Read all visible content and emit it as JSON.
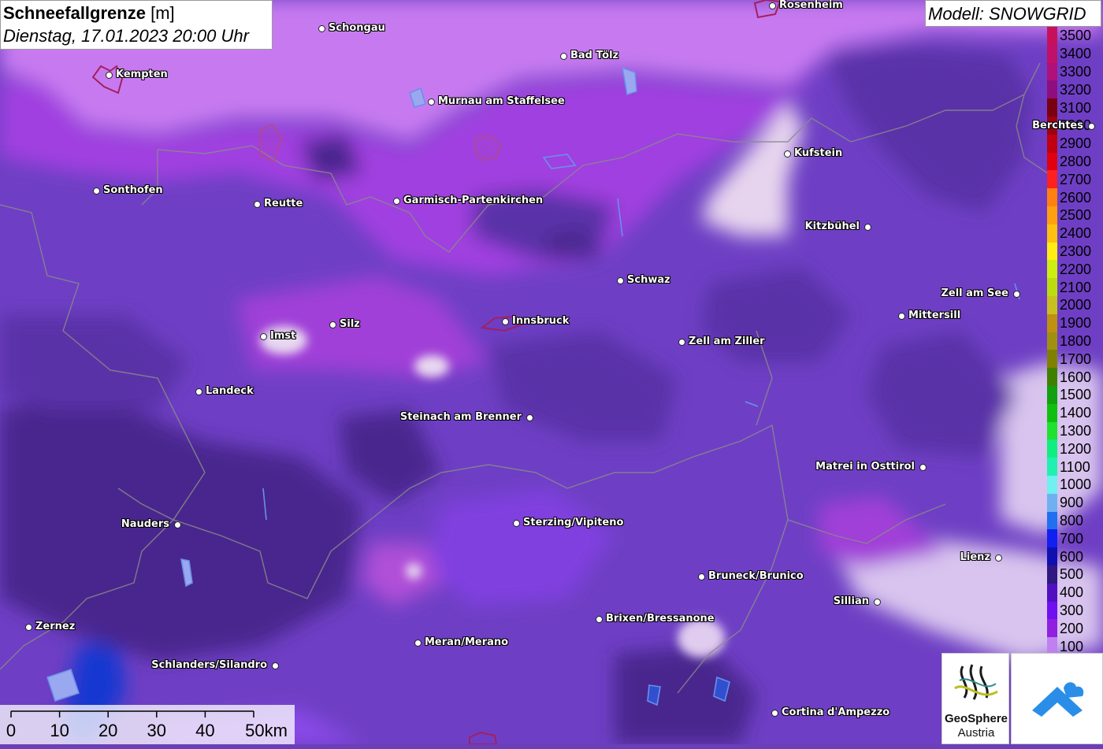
{
  "title": {
    "main": "Schneefallgrenze",
    "unit": "[m]",
    "datetime": "Dienstag, 17.01.2023 20:00 Uhr"
  },
  "model_label": "Modell: SNOWGRID",
  "legend": {
    "entries": [
      {
        "label": "3500",
        "color": "#c8105a"
      },
      {
        "label": "3400",
        "color": "#c0106a"
      },
      {
        "label": "3300",
        "color": "#b0107a"
      },
      {
        "label": "3200",
        "color": "#8e0e80"
      },
      {
        "label": "3100",
        "color": "#7a0010"
      },
      {
        "label": "3000",
        "color": "#a00010"
      },
      {
        "label": "2900",
        "color": "#c00010"
      },
      {
        "label": "2800",
        "color": "#e00010"
      },
      {
        "label": "2700",
        "color": "#ff2020"
      },
      {
        "label": "2600",
        "color": "#ff8010"
      },
      {
        "label": "2500",
        "color": "#ffa010"
      },
      {
        "label": "2400",
        "color": "#ffc010"
      },
      {
        "label": "2300",
        "color": "#ffee10"
      },
      {
        "label": "2200",
        "color": "#ccee10"
      },
      {
        "label": "2100",
        "color": "#bbdd10"
      },
      {
        "label": "2000",
        "color": "#c8c020"
      },
      {
        "label": "1900",
        "color": "#c09010"
      },
      {
        "label": "1800",
        "color": "#a09010"
      },
      {
        "label": "1700",
        "color": "#808000"
      },
      {
        "label": "1600",
        "color": "#408000"
      },
      {
        "label": "1500",
        "color": "#10a010"
      },
      {
        "label": "1400",
        "color": "#10c010"
      },
      {
        "label": "1300",
        "color": "#20e030"
      },
      {
        "label": "1200",
        "color": "#10ee80"
      },
      {
        "label": "1100",
        "color": "#20f0b0"
      },
      {
        "label": "1000",
        "color": "#70f0f0"
      },
      {
        "label": "900",
        "color": "#70b0f0"
      },
      {
        "label": "800",
        "color": "#2070f0"
      },
      {
        "label": "700",
        "color": "#1020f0"
      },
      {
        "label": "600",
        "color": "#1010b0"
      },
      {
        "label": "500",
        "color": "#301880"
      },
      {
        "label": "400",
        "color": "#5010c0"
      },
      {
        "label": "300",
        "color": "#7010f0"
      },
      {
        "label": "200",
        "color": "#9020e0"
      },
      {
        "label": "100",
        "color": "#c080f0"
      }
    ]
  },
  "scale_bar": {
    "labels": [
      "0",
      "10",
      "20",
      "30",
      "40",
      "50km"
    ]
  },
  "logo": {
    "line1": "GeoSphere",
    "line2": "Austria"
  },
  "cities": [
    {
      "name": "Rosenheim",
      "side": "right"
    },
    {
      "name": "Schongau",
      "side": "right"
    },
    {
      "name": "Bad Tölz",
      "side": "right"
    },
    {
      "name": "Kempten",
      "side": "right"
    },
    {
      "name": "Murnau am Staffelsee",
      "side": "right"
    },
    {
      "name": "Berchtes",
      "side": "left"
    },
    {
      "name": "Kufstein",
      "side": "right"
    },
    {
      "name": "Sonthofen",
      "side": "right"
    },
    {
      "name": "Reutte",
      "side": "right"
    },
    {
      "name": "Garmisch-Partenkirchen",
      "side": "right"
    },
    {
      "name": "Kitzbühel",
      "side": "left"
    },
    {
      "name": "Schwaz",
      "side": "right"
    },
    {
      "name": "Zell am See",
      "side": "left"
    },
    {
      "name": "Mittersill",
      "side": "right"
    },
    {
      "name": "Innsbruck",
      "side": "right"
    },
    {
      "name": "Silz",
      "side": "right"
    },
    {
      "name": "Imst",
      "side": "right"
    },
    {
      "name": "Zell am Ziller",
      "side": "right"
    },
    {
      "name": "Landeck",
      "side": "right"
    },
    {
      "name": "Steinach am Brenner",
      "side": "left"
    },
    {
      "name": "Matrei in Osttirol",
      "side": "left"
    },
    {
      "name": "Nauders",
      "side": "left"
    },
    {
      "name": "Sterzing/Vipiteno",
      "side": "right"
    },
    {
      "name": "Lienz",
      "side": "left"
    },
    {
      "name": "Bruneck/Brunico",
      "side": "right"
    },
    {
      "name": "Sillian",
      "side": "left"
    },
    {
      "name": "Brixen/Bressanone",
      "side": "right"
    },
    {
      "name": "Zernez",
      "side": "right"
    },
    {
      "name": "Meran/Merano",
      "side": "right"
    },
    {
      "name": "Schlanders/Silandro",
      "side": "left"
    },
    {
      "name": "Cortina d'Ampezzo",
      "side": "right"
    }
  ]
}
